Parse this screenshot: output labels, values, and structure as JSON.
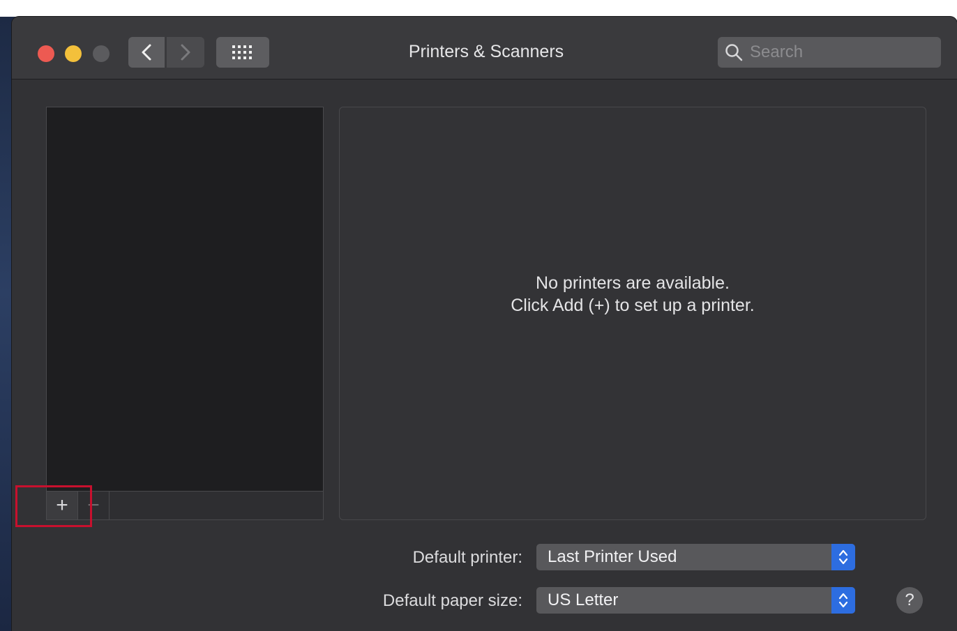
{
  "window": {
    "title": "Printers & Scanners",
    "search_placeholder": "Search"
  },
  "printer_list": {
    "add_button_label": "+",
    "remove_button_label": "−"
  },
  "detail": {
    "empty_line1": "No printers are available.",
    "empty_line2": "Click Add (+) to set up a printer."
  },
  "settings": {
    "default_printer_label": "Default printer:",
    "default_printer_value": "Last Printer Used",
    "default_paper_label": "Default paper size:",
    "default_paper_value": "US Letter"
  },
  "help_label": "?",
  "colors": {
    "window_bg": "#323235",
    "accent": "#2d6de0",
    "highlight": "#c8102e"
  }
}
